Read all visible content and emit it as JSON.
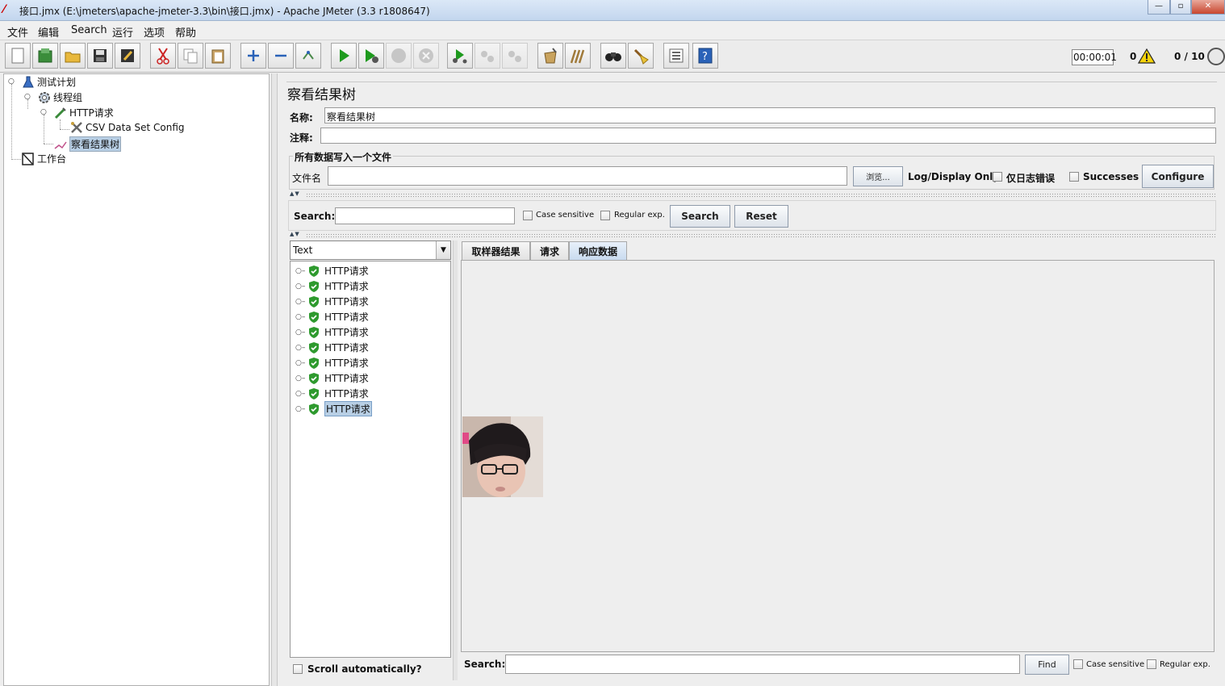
{
  "window": {
    "title": "接口.jmx (E:\\jmeters\\apache-jmeter-3.3\\bin\\接口.jmx) - Apache JMeter (3.3 r1808647)",
    "btn_minimize": "—",
    "btn_maximize": "▫",
    "btn_close": "✕"
  },
  "menu": [
    "文件",
    "编辑",
    "Search",
    "运行",
    "选项",
    "帮助"
  ],
  "toolbar": {
    "timer": "00:00:01",
    "error_count": "0",
    "threads": "0 / 10",
    "icons": [
      "new-icon",
      "templates-icon",
      "open-icon",
      "save-icon",
      "save-as-icon",
      "cut-icon",
      "copy-icon",
      "paste-icon",
      "expand-icon",
      "collapse-icon",
      "toggle-icon",
      "start-icon",
      "start-no-pause-icon",
      "stop-icon",
      "shutdown-icon",
      "remote-start-icon",
      "remote-stop-icon",
      "remote-shutdown-icon",
      "clear-icon",
      "clear-all-icon",
      "search-icon",
      "reset-search-icon",
      "function-helper-icon",
      "help-icon"
    ]
  },
  "tree": {
    "test_plan": "测试计划",
    "thread_group": "线程组",
    "http_request": "HTTP请求",
    "csv_config": "CSV Data Set Config",
    "result_tree": "察看结果树",
    "workbench": "工作台"
  },
  "panel": {
    "title": "察看结果树",
    "name_label": "名称:",
    "name_value": "察看结果树",
    "comment_label": "注释:",
    "comment_value": "",
    "file_group_title": "所有数据写入一个文件",
    "filename_label": "文件名",
    "filename_value": "",
    "browse_button": "浏览...",
    "log_display_only": "Log/Display Only:",
    "errors_only": "仅日志错误",
    "successes": "Successes",
    "configure_button": "Configure"
  },
  "search_bar": {
    "label": "Search:",
    "value": "",
    "case_sensitive": "Case sensitive",
    "regular_exp": "Regular exp.",
    "search_button": "Search",
    "reset_button": "Reset"
  },
  "results": {
    "renderer": "Text",
    "items": [
      "HTTP请求",
      "HTTP请求",
      "HTTP请求",
      "HTTP请求",
      "HTTP请求",
      "HTTP请求",
      "HTTP请求",
      "HTTP请求",
      "HTTP请求",
      "HTTP请求"
    ],
    "scroll_automatically": "Scroll automatically?"
  },
  "tabs": [
    "取样器结果",
    "请求",
    "响应数据"
  ],
  "active_tab": "响应数据",
  "response_search": {
    "label": "Search:",
    "value": "",
    "find_button": "Find",
    "case_sensitive": "Case sensitive",
    "regular_exp": "Regular exp."
  },
  "colors": {
    "selection": "#b8cfe5",
    "success_green": "#2e9a2e",
    "active_tab": "#c9dbef"
  }
}
